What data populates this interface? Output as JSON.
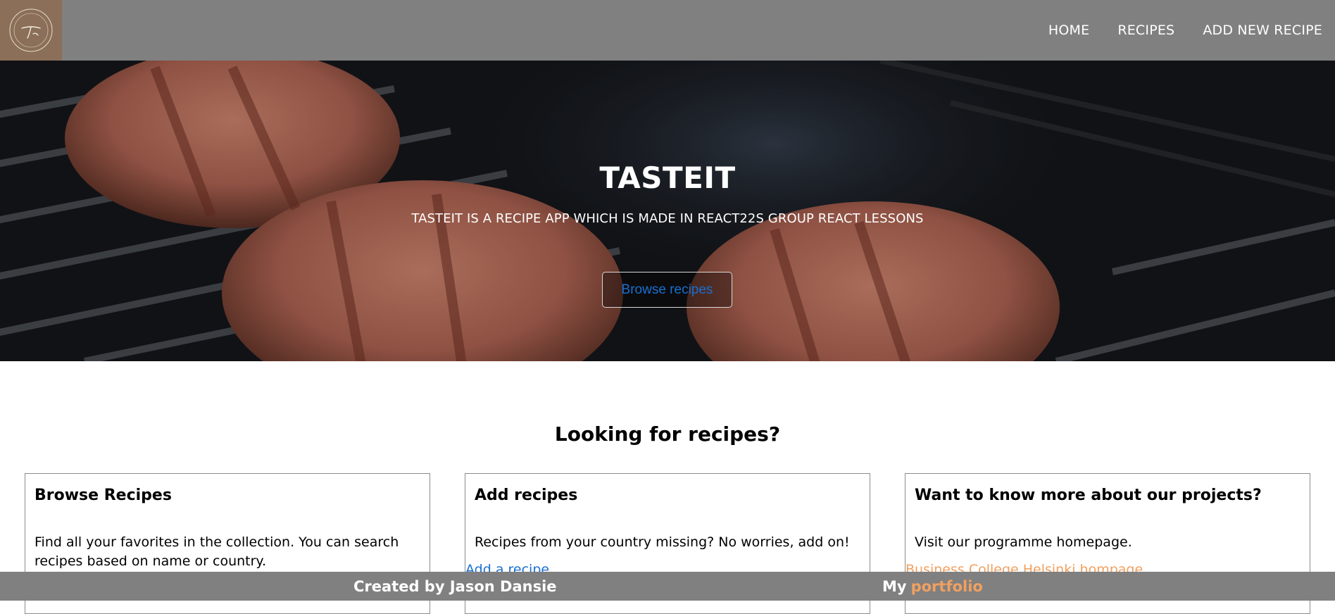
{
  "nav": {
    "logo_icon": "tasteit-logo-icon",
    "links": [
      {
        "label": "HOME"
      },
      {
        "label": "RECIPES"
      },
      {
        "label": "ADD NEW RECIPE"
      }
    ]
  },
  "hero": {
    "title": "TASTEIT",
    "subtitle": "TASTEIT IS A RECIPE APP WHICH IS MADE IN REACT22S GROUP REACT LESSONS",
    "button_label": "Browse recipes"
  },
  "main": {
    "title": "Looking for recipes?",
    "cards": [
      {
        "title": "Browse Recipes",
        "text": "Find all your favorites in the collection. You can search recipes based on name or country.",
        "link": "",
        "link_color": "#1a6fd0"
      },
      {
        "title": "Add recipes",
        "text": "Recipes from your country missing? No worries, add on!",
        "link": "Add a recipe",
        "link_color": "#1a6fd0"
      },
      {
        "title": "Want to know more about our projects?",
        "text": "Visit our programme homepage.",
        "link": "Business College Helsinki hompage",
        "link_color": "#f0a060"
      }
    ]
  },
  "footer": {
    "created_by": "Created by Jason Dansie",
    "my_label": "My",
    "portfolio_link": "portfolio"
  },
  "colors": {
    "nav_background": "#808080",
    "logo_background": "#8b6f58",
    "link_blue": "#1a6fd0",
    "accent_orange": "#f0a060"
  }
}
